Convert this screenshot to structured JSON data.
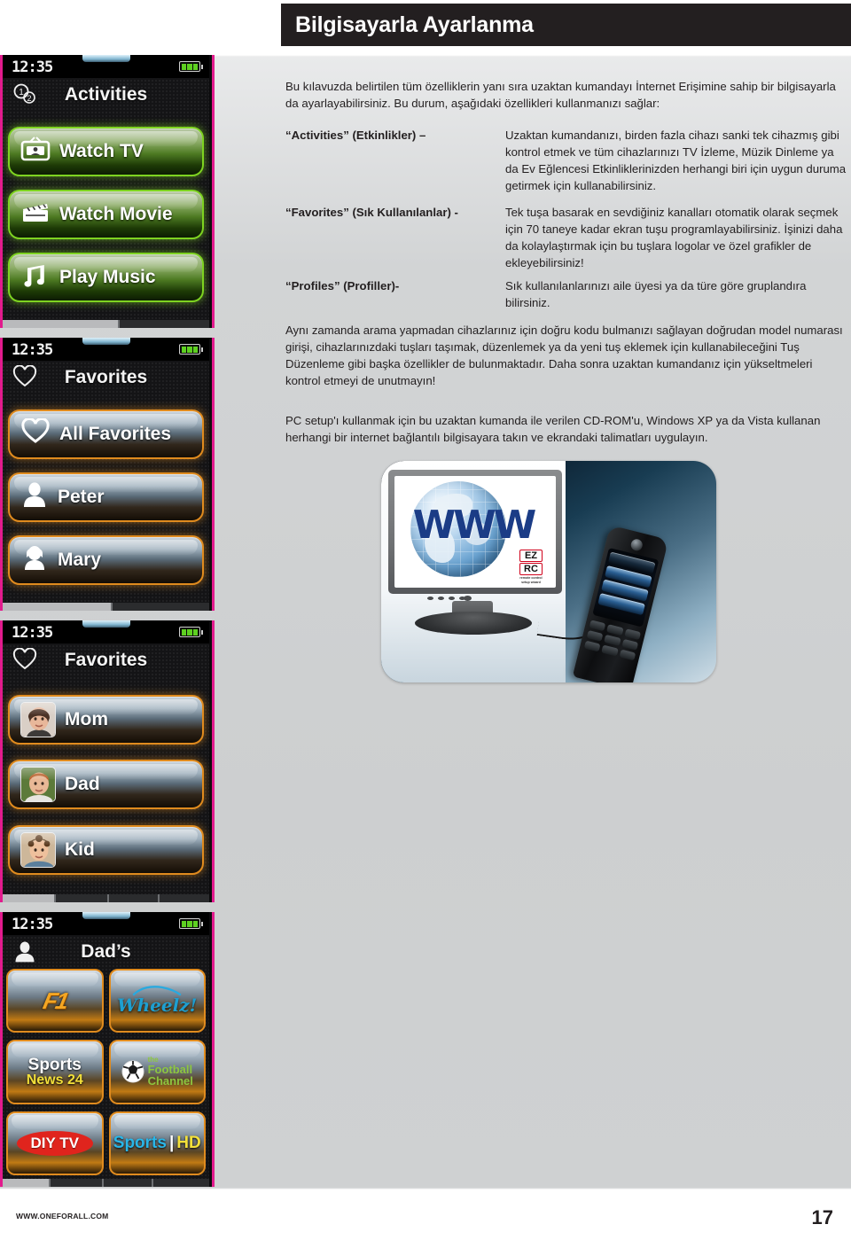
{
  "header": {
    "title": "Bilgisayarla Ayarlanma"
  },
  "intro": {
    "paragraph": "Bu kılavuzda belirtilen tüm özelliklerin yanı sıra uzaktan kumandayı İnternet Erişimine sahip bir bilgisayarla da ayarlayabilirsiniz. Bu durum, aşağıdaki özellikleri kullanmanızı sağlar:"
  },
  "definitions": [
    {
      "label": "“Activities” (Etkinlikler) –",
      "body": "Uzaktan kumandanızı, birden fazla cihazı sanki tek cihazmış gibi kontrol etmek ve tüm cihazlarınızı TV İzleme, Müzik Dinleme ya da Ev Eğlencesi Etkinliklerinizden herhangi biri için uygun duruma getirmek için kullanabilirsiniz."
    },
    {
      "label": "“Favorites” (Sık Kullanılanlar) -",
      "body": "Tek tuşa basarak en sevdiğiniz kanalları otomatik olarak seçmek için 70 taneye kadar ekran tuşu programlayabilirsiniz. İşinizi daha da kolaylaştırmak için bu tuşlara logolar ve özel grafikler de ekleyebilirsiniz!"
    },
    {
      "label": "“Profiles” (Profiller)-",
      "body": "Sık kullanılanlarınızı aile üyesi ya da türe göre gruplandıra bilirsiniz."
    }
  ],
  "paragraphs": {
    "features": "Aynı zamanda arama yapmadan cihazlarınız için doğru kodu bulmanızı sağlayan doğrudan model numarası girişi, cihazlarınızdaki tuşları taşımak, düzenlemek ya da yeni tuş eklemek için kullanabileceğini Tuş Düzenleme gibi başka özellikler de bulunmaktadır. Daha sonra uzaktan kumandanız için yükseltmeleri kontrol etmeyi de unutmayın!",
    "setup": "PC setup'ı kullanmak için bu uzaktan kumanda ile verilen CD-ROM'u, Windows XP ya da Vista kullanan herhangi bir internet bağlantılı bilgisayara takın ve ekrandaki talimatları uygulayın."
  },
  "screens": [
    {
      "clock": "12:35",
      "title": "Activities",
      "title_icon": "activities-icon",
      "theme_color": "#7ed321",
      "items": [
        {
          "label": "Watch TV",
          "icon": "tv-icon"
        },
        {
          "label": "Watch Movie",
          "icon": "clapperboard-icon"
        },
        {
          "label": "Play Music",
          "icon": "music-note-icon"
        }
      ]
    },
    {
      "clock": "12:35",
      "title": "Favorites",
      "title_icon": "heart-icon",
      "theme_color": "#e08b1e",
      "items": [
        {
          "label": "All Favorites",
          "icon": "heart-icon"
        },
        {
          "label": "Peter",
          "icon": "person-icon"
        },
        {
          "label": "Mary",
          "icon": "person-icon"
        }
      ]
    },
    {
      "clock": "12:35",
      "title": "Favorites",
      "title_icon": "heart-icon",
      "theme_color": "#e08b1e",
      "items": [
        {
          "label": "Mom",
          "icon": "photo-avatar-mom"
        },
        {
          "label": "Dad",
          "icon": "photo-avatar-dad"
        },
        {
          "label": "Kid",
          "icon": "photo-avatar-kid"
        }
      ]
    },
    {
      "clock": "12:35",
      "title": "Dad’s",
      "title_icon": "person-icon",
      "theme_color": "#e08b1e",
      "tiles": [
        {
          "name": "F1",
          "type": "f1-logo"
        },
        {
          "name": "Wheelz!",
          "type": "wheelz-logo"
        },
        {
          "name": "Sports News 24",
          "line1": "Sports",
          "line2": "News 24",
          "type": "sports-news-logo"
        },
        {
          "name": "the Football Channel",
          "line1": "the",
          "line2": "Football",
          "line3": "Channel",
          "type": "football-channel-logo"
        },
        {
          "name": "DIY TV",
          "type": "diy-tv-logo"
        },
        {
          "name": "Sports HD",
          "line1": "Sports",
          "sep": "|",
          "line2": "HD",
          "type": "sports-hd-logo"
        }
      ]
    }
  ],
  "illustration": {
    "monitor_text": "WWW",
    "badge": {
      "line1": "EZ",
      "line2": "RC",
      "caption1": "remote control",
      "caption2": "setup wizard"
    }
  },
  "footer": {
    "url": "WWW.ONEFORALL.COM",
    "page": "17"
  }
}
